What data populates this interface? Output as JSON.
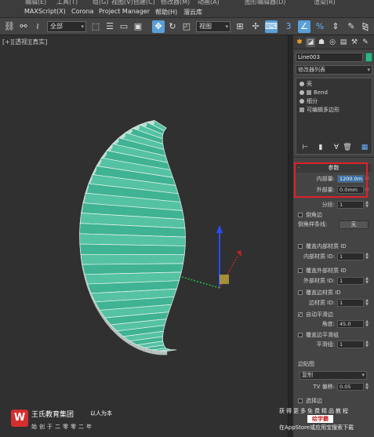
{
  "top_menu_partial": [
    "编辑(E)",
    "工具(T)",
    "组(G)",
    "视图(V)",
    "创建(C)",
    "修改器(M)",
    "动画(A)",
    "图形编辑器(D)",
    "渲染(R)"
  ],
  "menubar": [
    "MAXScript(X)",
    "Corona",
    "Project Manager",
    "帮助(H)",
    "溜云库"
  ],
  "toolbar": {
    "selection_filter": "全部",
    "reference_coord": "视图"
  },
  "viewport": {
    "label": "[+][透视][真实]"
  },
  "panel": {
    "object_name": "Line003",
    "object_color": "#2fb384",
    "modifier_list": "修改器列表",
    "stack": [
      "壳",
      "Bend",
      "细分",
      "可编辑多边形"
    ],
    "params_title": "参数",
    "inner_amount_label": "内部量:",
    "inner_amount_value": "1200.0m",
    "outer_amount_label": "外部量:",
    "outer_amount_value": "0.0mm",
    "segments_label": "分段:",
    "segments_value": "1",
    "bevel_edges_label": "倒角边",
    "bevel_spline_label": "倒角样条线:",
    "bevel_spline_value": "无",
    "override_inner_label": "覆盖内部材质 ID",
    "inner_mat_label": "内部材质 ID:",
    "inner_mat_value": "1",
    "override_outer_label": "覆盖外部材质 ID",
    "outer_mat_label": "外部材质 ID:",
    "outer_mat_value": "1",
    "override_edge_label": "覆盖边材质 ID",
    "edge_mat_label": "边材质 ID:",
    "edge_mat_value": "1",
    "auto_smooth_label": "自动平滑边",
    "angle_label": "角度:",
    "angle_value": "45.0",
    "override_smooth_label": "覆盖边平滑组",
    "smooth_group_label": "平滑组:",
    "smooth_group_value": "1",
    "edge_mapping_label": "边贴图",
    "edge_mapping_value": "复制",
    "tv_offset_label": "TV 偏移:",
    "tv_offset_value": "0.05",
    "select_edges_label": "选择边"
  },
  "watermark": {
    "logo_letter": "W",
    "company": "王氏教育集团",
    "slogan": "以人为本",
    "subline": "始创于二零零二年",
    "right_line1": "获得更多免费精品教程",
    "right_badge": "绘学霸",
    "right_line3": "在AppStore或应用宝搜索下载"
  }
}
